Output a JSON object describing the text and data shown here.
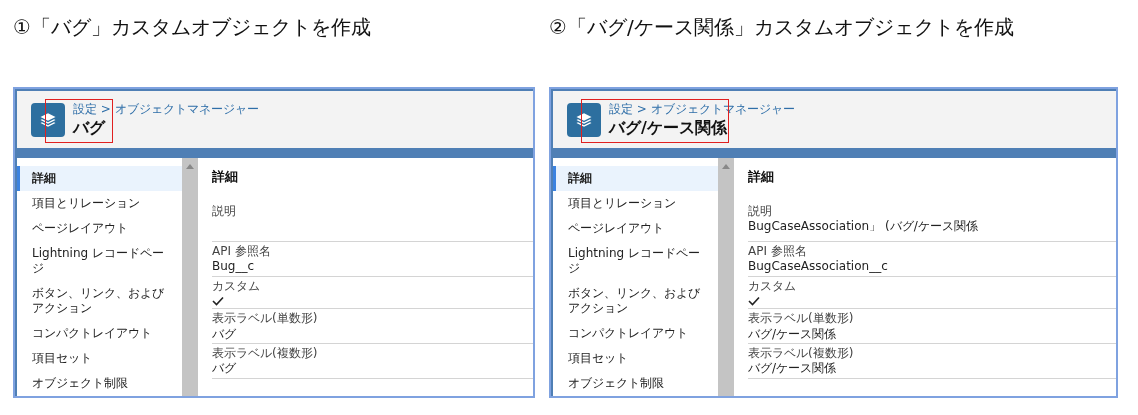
{
  "steps": [
    {
      "heading": "①「バグ」カスタムオブジェクトを作成",
      "breadcrumb": "設定 > オブジェクトマネージャー",
      "object_title": "バグ",
      "nav_items": [
        {
          "label": "詳細",
          "selected": true
        },
        {
          "label": "項目とリレーション",
          "selected": false
        },
        {
          "label": "ページレイアウト",
          "selected": false
        },
        {
          "label": "Lightning レコードページ",
          "selected": false
        },
        {
          "label": "ボタン、リンク、およびアクション",
          "selected": false
        },
        {
          "label": "コンパクトレイアウト",
          "selected": false
        },
        {
          "label": "項目セット",
          "selected": false
        },
        {
          "label": "オブジェクト制限",
          "selected": false
        }
      ],
      "detail_heading": "詳細",
      "fields": [
        {
          "kind": "text",
          "label": "説明"
        },
        {
          "kind": "text",
          "label": "API 参照名",
          "value": "Bug__c"
        },
        {
          "kind": "check",
          "label": "カスタム",
          "checked": true
        },
        {
          "kind": "text",
          "label": "表示ラベル(単数形)",
          "value": "バグ"
        },
        {
          "kind": "text",
          "label": "表示ラベル(複数形)",
          "value": "バグ"
        }
      ]
    },
    {
      "heading": "②「バグ/ケース関係」カスタムオブジェクトを作成",
      "breadcrumb": "設定 > オブジェクトマネージャー",
      "object_title": "バグ/ケース関係",
      "nav_items": [
        {
          "label": "詳細",
          "selected": true
        },
        {
          "label": "項目とリレーション",
          "selected": false
        },
        {
          "label": "ページレイアウト",
          "selected": false
        },
        {
          "label": "Lightning レコードページ",
          "selected": false
        },
        {
          "label": "ボタン、リンク、およびアクション",
          "selected": false
        },
        {
          "label": "コンパクトレイアウト",
          "selected": false
        },
        {
          "label": "項目セット",
          "selected": false
        },
        {
          "label": "オブジェクト制限",
          "selected": false
        }
      ],
      "detail_heading": "詳細",
      "fields": [
        {
          "kind": "text",
          "label": "説明",
          "value": "BugCaseAssociation」 (バグ/ケース関係"
        },
        {
          "kind": "text",
          "label": "API 参照名",
          "value": "BugCaseAssociation__c"
        },
        {
          "kind": "check",
          "label": "カスタム",
          "checked": true
        },
        {
          "kind": "text",
          "label": "表示ラベル(単数形)",
          "value": "バグ/ケース関係"
        },
        {
          "kind": "text",
          "label": "表示ラベル(複数形)",
          "value": "バグ/ケース関係"
        }
      ]
    }
  ]
}
